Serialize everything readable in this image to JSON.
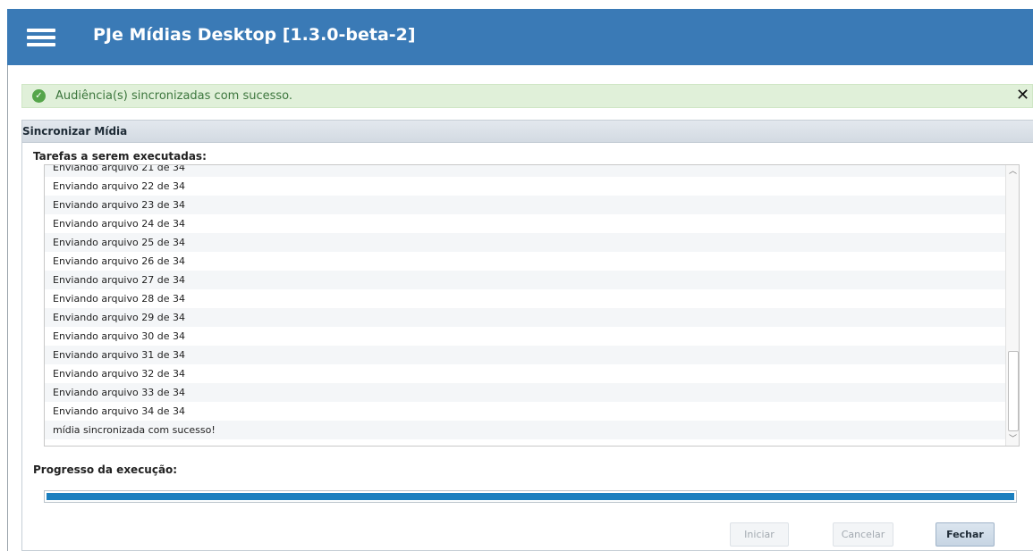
{
  "app": {
    "title": "PJe Mídias Desktop [1.3.0-beta-2]"
  },
  "alert": {
    "icon": "check-circle-icon",
    "message": "Audiência(s) sincronizadas com sucesso.",
    "close_label": "✕"
  },
  "panel": {
    "title": "Sincronizar Mídia",
    "tasks_label": "Tarefas a serem executadas:",
    "tasks": [
      "Enviando arquivo 21 de 34",
      "Enviando arquivo 22 de 34",
      "Enviando arquivo 23 de 34",
      "Enviando arquivo 24 de 34",
      "Enviando arquivo 25 de 34",
      "Enviando arquivo 26 de 34",
      "Enviando arquivo 27 de 34",
      "Enviando arquivo 28 de 34",
      "Enviando arquivo 29 de 34",
      "Enviando arquivo 30 de 34",
      "Enviando arquivo 31 de 34",
      "Enviando arquivo 32 de 34",
      "Enviando arquivo 33 de 34",
      "Enviando arquivo 34 de 34",
      "mídia sincronizada com sucesso!"
    ],
    "progress_label": "Progresso da execução:",
    "progress_percent": 100
  },
  "buttons": {
    "start": "Iniciar",
    "cancel": "Cancelar",
    "close": "Fechar"
  },
  "colors": {
    "header": "#3a7ab6",
    "alert_bg": "#e0f0d9",
    "alert_text": "#3c763d",
    "progress": "#1b7fbf"
  }
}
